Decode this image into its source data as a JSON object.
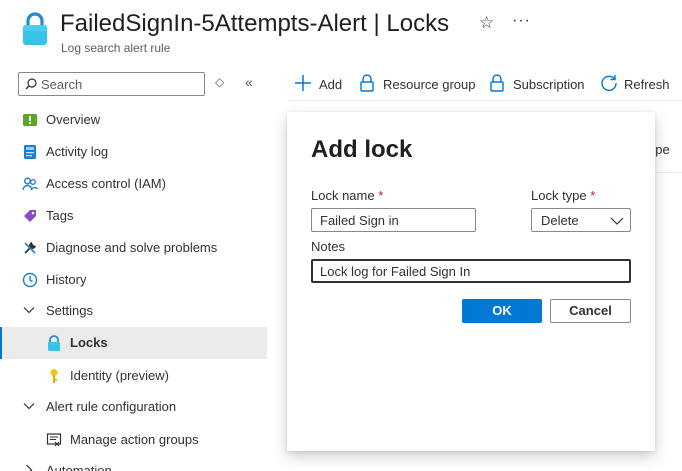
{
  "header": {
    "title": "FailedSignIn-5Attempts-Alert | Locks",
    "subtitle": "Log search alert rule",
    "resource_icon": "lock-icon",
    "favorite_icon": "star-icon",
    "more_icon": "ellipsis-icon"
  },
  "sidebar": {
    "search_placeholder": "Search",
    "items": [
      {
        "label": "Overview",
        "icon": "overview-icon"
      },
      {
        "label": "Activity log",
        "icon": "activity-log-icon"
      },
      {
        "label": "Access control (IAM)",
        "icon": "people-icon"
      },
      {
        "label": "Tags",
        "icon": "tag-icon"
      },
      {
        "label": "Diagnose and solve problems",
        "icon": "wrench-icon"
      },
      {
        "label": "History",
        "icon": "clock-icon"
      },
      {
        "label": "Settings",
        "icon": "chevron-down-icon",
        "expanded": true
      },
      {
        "label": "Locks",
        "icon": "lock-icon",
        "selected": true
      },
      {
        "label": "Identity (preview)",
        "icon": "key-icon"
      },
      {
        "label": "Alert rule configuration",
        "icon": "chevron-down-icon",
        "expanded": true
      },
      {
        "label": "Manage action groups",
        "icon": "action-group-icon"
      },
      {
        "label": "Automation",
        "icon": "chevron-right-icon"
      }
    ]
  },
  "commandbar": {
    "add": "Add",
    "resource_group": "Resource group",
    "subscription": "Subscription",
    "refresh": "Refresh"
  },
  "background": {
    "scope_fragment": "ope"
  },
  "modal": {
    "title": "Add lock",
    "lock_name_label": "Lock name",
    "lock_name_value": "Failed Sign in",
    "lock_type_label": "Lock type",
    "lock_type_value": "Delete",
    "required_marker": "*",
    "notes_label": "Notes",
    "notes_value": "Lock log for Failed Sign In",
    "ok": "OK",
    "cancel": "Cancel"
  },
  "colors": {
    "accent": "#0078d4",
    "required": "#a4262c",
    "selected_bg": "#edebe9"
  }
}
